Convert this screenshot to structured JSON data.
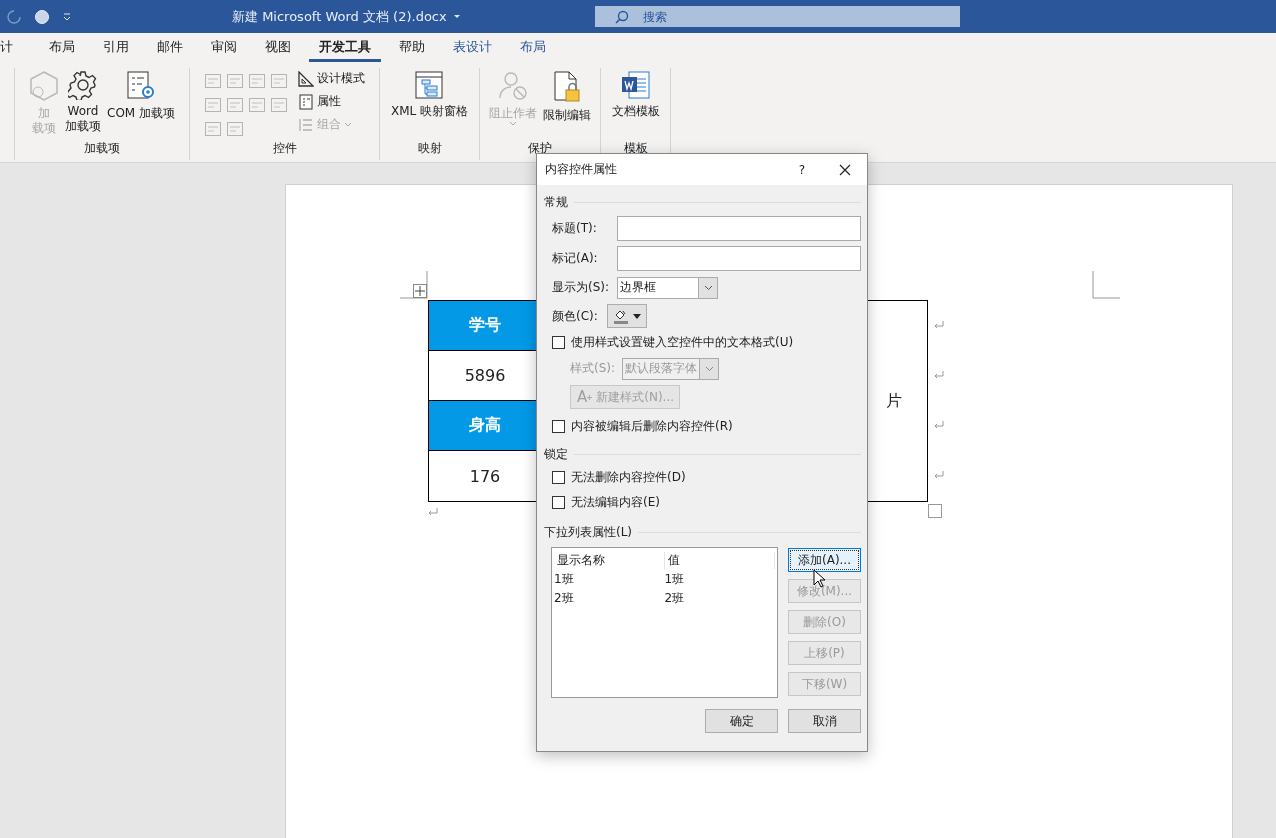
{
  "title_bar": {
    "title": "新建 Microsoft Word 文档 (2).docx",
    "search_placeholder": "搜索"
  },
  "tabs": [
    {
      "label": "计",
      "selected": false,
      "contextual": false
    },
    {
      "label": "布局",
      "selected": false,
      "contextual": false
    },
    {
      "label": "引用",
      "selected": false,
      "contextual": false
    },
    {
      "label": "邮件",
      "selected": false,
      "contextual": false
    },
    {
      "label": "审阅",
      "selected": false,
      "contextual": false
    },
    {
      "label": "视图",
      "selected": false,
      "contextual": false
    },
    {
      "label": "开发工具",
      "selected": true,
      "contextual": false
    },
    {
      "label": "帮助",
      "selected": false,
      "contextual": false
    },
    {
      "label": "表设计",
      "selected": false,
      "contextual": true
    },
    {
      "label": "布局",
      "selected": false,
      "contextual": true
    }
  ],
  "ribbon": {
    "addins": {
      "label": "加载项",
      "items": [
        {
          "kind": "hexagon",
          "lines": [
            "加",
            "载项"
          ],
          "disabled": true
        },
        {
          "kind": "gear",
          "lines": [
            "Word",
            "加载项"
          ],
          "disabled": false
        },
        {
          "kind": "com",
          "lines": [
            "COM 加载项"
          ],
          "disabled": false
        }
      ]
    },
    "controls": {
      "label": "控件",
      "commands": [
        {
          "kind": "design",
          "label": "设计模式",
          "disabled": false
        },
        {
          "kind": "properties",
          "label": "属性",
          "disabled": false
        },
        {
          "kind": "group",
          "label": "组合",
          "disabled": true
        }
      ]
    },
    "mapping": {
      "label": "映射",
      "items": [
        {
          "kind": "xml",
          "lines": [
            "XML 映射窗格"
          ],
          "disabled": false
        }
      ]
    },
    "protect": {
      "label": "保护",
      "items": [
        {
          "kind": "block",
          "lines": [
            "阻止作者"
          ],
          "disabled": true
        },
        {
          "kind": "lock",
          "lines": [
            "限制编辑"
          ],
          "disabled": false
        }
      ]
    },
    "templates": {
      "label": "模板",
      "items": [
        {
          "kind": "word",
          "lines": [
            "文档模板"
          ],
          "disabled": false
        }
      ]
    }
  },
  "document": {
    "table": {
      "rows": [
        {
          "kind": "header",
          "text": "学号"
        },
        {
          "kind": "value",
          "text": "5896"
        },
        {
          "kind": "header",
          "text": "身高"
        },
        {
          "kind": "value",
          "text": "176"
        }
      ],
      "photo_cell": "片"
    }
  },
  "dialog": {
    "title": "内容控件属性",
    "help": "?",
    "general": {
      "heading": "常规",
      "title_label": "标题(T):",
      "tag_label": "标记(A):",
      "show_as_label": "显示为(S):",
      "show_as_value": "边界框",
      "color_label": "颜色(C):",
      "use_style": {
        "label": "使用样式设置键入空控件中的文本格式(U)",
        "checked": false
      },
      "style_label": "样式(S):",
      "style_value": "默认段落字体",
      "new_style_icon": "A",
      "new_style_button": "新建样式(N)...",
      "remove": {
        "label": "内容被编辑后删除内容控件(R)",
        "checked": false
      }
    },
    "locking": {
      "heading": "锁定",
      "options": [
        {
          "label": "无法删除内容控件(D)",
          "checked": false
        },
        {
          "label": "无法编辑内容(E)",
          "checked": false
        }
      ]
    },
    "dropdown": {
      "heading": "下拉列表属性(L)",
      "columns": [
        "显示名称",
        "值"
      ],
      "rows": [
        [
          "1班",
          "1班"
        ],
        [
          "2班",
          "2班"
        ]
      ],
      "buttons": [
        {
          "label": "添加(A)...",
          "disabled": false,
          "focused": true
        },
        {
          "label": "修改(M)...",
          "disabled": true,
          "focused": false
        },
        {
          "label": "删除(O)",
          "disabled": true,
          "focused": false
        },
        {
          "label": "上移(P)",
          "disabled": true,
          "focused": false
        },
        {
          "label": "下移(W)",
          "disabled": true,
          "focused": false
        }
      ]
    },
    "footer_buttons": [
      "确定",
      "取消"
    ]
  }
}
